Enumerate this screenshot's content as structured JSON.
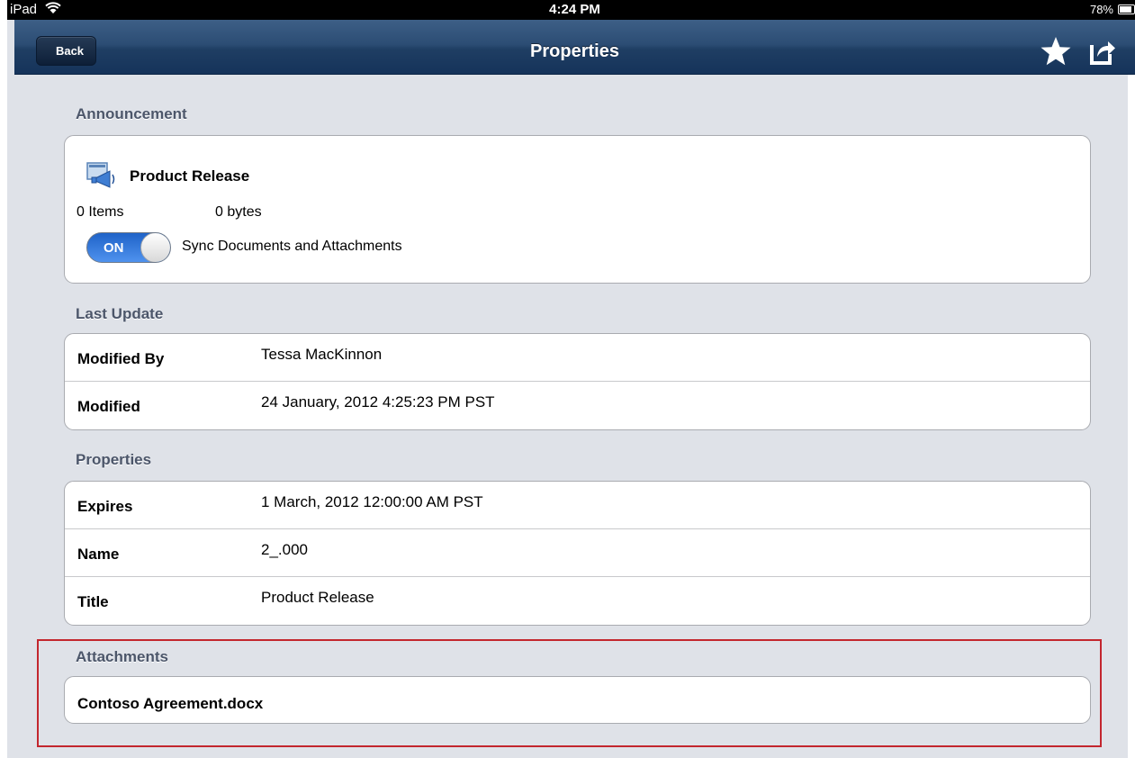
{
  "status_bar": {
    "carrier": "iPad",
    "time": "4:24 PM",
    "battery": "78%",
    "battery_level": 0.78
  },
  "nav": {
    "back_label": "Back",
    "title": "Properties",
    "star_icon": "star-icon",
    "share_icon": "share-icon"
  },
  "announcement": {
    "header": "Announcement",
    "icon": "announcement-megaphone-icon",
    "title": "Product Release",
    "items": "0 Items",
    "size": "0 bytes",
    "toggle_label": "ON",
    "toggle_state": true,
    "sync_label": "Sync Documents and Attachments"
  },
  "last_update": {
    "header": "Last Update",
    "rows": [
      {
        "label": "Modified By",
        "value": "Tessa MacKinnon"
      },
      {
        "label": "Modified",
        "value": "24 January, 2012 4:25:23 PM PST"
      }
    ]
  },
  "properties": {
    "header": "Properties",
    "rows": [
      {
        "label": "Expires",
        "value": "1 March, 2012 12:00:00 AM PST"
      },
      {
        "label": "Name",
        "value": "2_.000"
      },
      {
        "label": "Title",
        "value": "Product Release"
      }
    ]
  },
  "attachments": {
    "header": "Attachments",
    "items": [
      "Contoso Agreement.docx"
    ]
  },
  "colors": {
    "nav_bar": "#2c4d74",
    "background": "#dfe2e8",
    "section_header": "#4c566a",
    "toggle_on": "#2f76dc",
    "highlight_box": "#c3262e"
  }
}
